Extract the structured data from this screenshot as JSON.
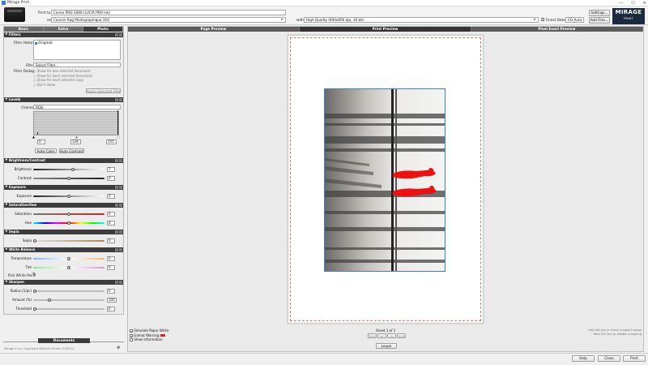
{
  "window": {
    "title": "Mirage Print",
    "controls": [
      "—",
      "☐",
      "✕"
    ]
  },
  "topbar": {
    "print_to_label": "Print to",
    "printer": "Canon PRO-1000 (LUCIA PRO Ink)",
    "on_label": "on",
    "media": "Canson Rag Photographique 310",
    "with_label": "with",
    "quality": "High Quality (600x600 dpi, 16 bit)",
    "finest_details": "Finest Details",
    "finest_checked": "✓",
    "color_mode": "CO Auto",
    "settings_button": "Settings...",
    "add_files_button": "Add Files...",
    "logo_main": "MIRAGE",
    "logo_sub": "PRINT"
  },
  "left_tabs": [
    "Basic",
    "Extra",
    "Photo"
  ],
  "filters": {
    "header": "Filters",
    "history_label": "Filter History",
    "history_item": "Original",
    "filter_label": "Filter",
    "filter_value": "Select Filter...",
    "dialog_label": "Filter Dialog",
    "options": [
      "Show for one selected document",
      "Show for each selected document",
      "Show for each selected copy",
      "Don't show"
    ],
    "apply_button": "Apply Selected Filter"
  },
  "levels": {
    "header": "Levels",
    "channel_label": "Channel",
    "channel_value": "RGB",
    "black": "0",
    "mid": "128",
    "white": "255",
    "auto_color": "Auto Color",
    "auto_contrast": "Auto Contrast"
  },
  "brightness": {
    "header": "Brightness/Contrast",
    "brightness_label": "Brightness",
    "brightness_value": "7",
    "contrast_label": "Contrast",
    "contrast_value": "0"
  },
  "exposure": {
    "header": "Exposure",
    "label": "Exposure",
    "value": "0"
  },
  "saturation": {
    "header": "Saturation/Hue",
    "sat_label": "Saturation",
    "sat_value": "0",
    "hue_label": "Hue",
    "hue_value": "0"
  },
  "sepia": {
    "header": "Sepia",
    "label": "Sepia",
    "value": "0"
  },
  "white_balance": {
    "header": "White Balance",
    "temp_label": "Temperature",
    "temp_value": "0",
    "tint_label": "Tint",
    "tint_value": "0",
    "pick_label": "Pick White Point"
  },
  "sharpen": {
    "header": "Sharpen",
    "radius_label": "Radius (1/pc)",
    "radius_value": "0",
    "amount_label": "Amount (%)",
    "amount_value": "100",
    "threshold_label": "Threshold",
    "threshold_value": "0"
  },
  "documents_button": "Documents",
  "version_text": "Mirage 4.x.x, Copyright Dietrich GmbH (©2021)",
  "center_tabs": [
    "Page Preview",
    "Print Preview",
    "Pixel Exact Preview"
  ],
  "preview_options": {
    "simulate_paper_white": "Simulate Paper White",
    "gamut_warning": "Gamut Warning",
    "show_information": "Show Information",
    "simulate_checked": "✓",
    "gamut_checked": "✓",
    "gamut_color": "#e02020"
  },
  "sheet": {
    "label": "Sheet 1 of 1",
    "nav": [
      "|<<",
      "<",
      ">",
      ">>|"
    ],
    "loupe": "Loupe"
  },
  "hints": [
    "Hold Alt key to move cropped image",
    "Hold Ctrl key to disable snapping"
  ],
  "bottom_buttons": {
    "help": "Help",
    "close": "Close",
    "print": "Print"
  }
}
